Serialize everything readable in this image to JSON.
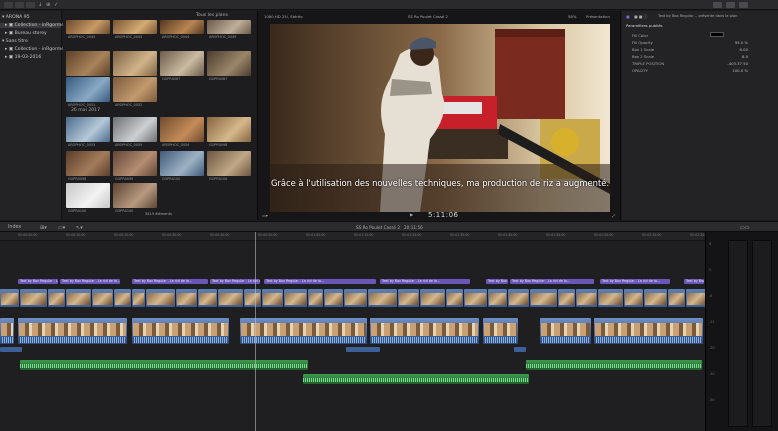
{
  "toolbar": {
    "left_icons": [
      "library-icon",
      "photos-icon",
      "titles-icon"
    ],
    "center_icons": [
      "import-icon",
      "keyword-icon",
      "check-icon"
    ],
    "right_icons": [
      "browser-toggle-icon",
      "timeline-toggle-icon",
      "inspector-toggle-icon"
    ]
  },
  "library": {
    "items": [
      {
        "label": "ARONA 95",
        "indent": 0,
        "selected": false
      },
      {
        "label": "Collection - inRgorme",
        "indent": 1,
        "selected": true
      },
      {
        "label": "Bureau storey",
        "indent": 1,
        "selected": false
      },
      {
        "label": "Sans titre",
        "indent": 0,
        "selected": false
      },
      {
        "label": "Collection - inRgorme",
        "indent": 1,
        "selected": false
      },
      {
        "label": "19-03-2016",
        "indent": 1,
        "selected": false
      }
    ]
  },
  "browser": {
    "filter_label": "Tous les plans",
    "date_group": "26 mai 2017",
    "count_label": "3415 éléments",
    "thumbs": [
      {
        "label": "AROPHOC_0045",
        "c1": "#6b4a2e",
        "c2": "#c89a66"
      },
      {
        "label": "AROPHOC_0043",
        "c1": "#7a5533",
        "c2": "#d3ab74"
      },
      {
        "label": "AROPHOC_0044",
        "c1": "#563821",
        "c2": "#b88552"
      },
      {
        "label": "AROPHOC_0049",
        "c1": "#6a5a4a",
        "c2": "#bfae98"
      },
      {
        "label": "AROPHOC_0048",
        "c1": "#5c4129",
        "c2": "#a8835a"
      },
      {
        "label": "AROPHOC_0050",
        "c1": "#7e6244",
        "c2": "#d1b48a"
      },
      {
        "label": "GOPR0087",
        "c1": "#6b5b49",
        "c2": "#cbbba2"
      },
      {
        "label": "GOPR0087",
        "c1": "#4b3c2f",
        "c2": "#9a8669"
      },
      {
        "label": "AROPHOC_0051",
        "c1": "#355a7f",
        "c2": "#8aa9c6"
      },
      {
        "label": "AROPHOC_0052",
        "c1": "#7c5a3c",
        "c2": "#c29a6e"
      },
      {
        "label": "AROPHOC_0053",
        "c1": "#4a6b8c",
        "c2": "#b5c8d8"
      },
      {
        "label": "AROPHOC_0055",
        "c1": "#6d6f72",
        "c2": "#cdd0d3"
      },
      {
        "label": "AROPHOC_0054",
        "c1": "#6f4b2d",
        "c2": "#c48b58"
      },
      {
        "label": "GOPR0098",
        "c1": "#85643f",
        "c2": "#d7b88b"
      },
      {
        "label": "GOPR0098",
        "c1": "#5a3e2a",
        "c2": "#a37b5b"
      },
      {
        "label": "GOPR0099",
        "c1": "#624636",
        "c2": "#b48d72"
      },
      {
        "label": "GOPR0100",
        "c1": "#3f5a7a",
        "c2": "#9fb2c5"
      },
      {
        "label": "GOPR0100",
        "c1": "#6b553f",
        "c2": "#c1a887"
      },
      {
        "label": "GOPR0100",
        "c1": "#c8c8c8",
        "c2": "#f2f2f2"
      },
      {
        "label": "GOPR0100",
        "c1": "#5a4333",
        "c2": "#b89a80"
      }
    ]
  },
  "viewer": {
    "info_left": "1080 HD 25i, Stéréo",
    "clip_name": "SS Ro Poulet Cassé 2",
    "zoom": "58%",
    "view_menu": "Présentation",
    "timecode": "5:11:06",
    "subtitle": "Grâce à l'utilisation des nouvelles techniques, ma production de riz a augmenté."
  },
  "inspector": {
    "title": "Text by Box Regular -- présente dans le plan",
    "section": "Paramètres publiés",
    "rows": [
      {
        "label": "Fill Color",
        "value": ""
      },
      {
        "label": "Fill Opacity",
        "value": "95.0 %"
      },
      {
        "label": "Box 1 Scale",
        "value": "6.00"
      },
      {
        "label": "Box 2 Scale",
        "value": "8.0"
      },
      {
        "label": "TRIPLE POSITION",
        "value": "-403.37  50"
      },
      {
        "label": "OPACITY",
        "value": "100.0 %"
      }
    ]
  },
  "timeline": {
    "index_label": "Index",
    "sequence": "SS Ro Poulet Cassé 2",
    "sequence_duration": "20:11:56",
    "ruler": [
      "00:00:00:00",
      "00:00:10:00",
      "00:00:20:00",
      "00:00:30:00",
      "00:00:40:00",
      "00:00:50:00",
      "00:01:00:00",
      "00:01:10:00",
      "00:01:20:00",
      "00:01:30:00",
      "00:01:40:00",
      "00:01:50:00",
      "00:02:00:00",
      "00:02:10:00",
      "00:02:20:00"
    ],
    "title_clip_label": "Text by Box Regular - La rizi de la..."
  },
  "meter": {
    "labels": [
      "6",
      "0",
      "-6",
      "-12",
      "-20",
      "-30",
      "-50"
    ]
  },
  "colors": {
    "title_clip": "#6a55b8",
    "video_clip": "#3c5f97",
    "audio_clip": "#2f7c3e",
    "selection": "#3a3a3e"
  }
}
